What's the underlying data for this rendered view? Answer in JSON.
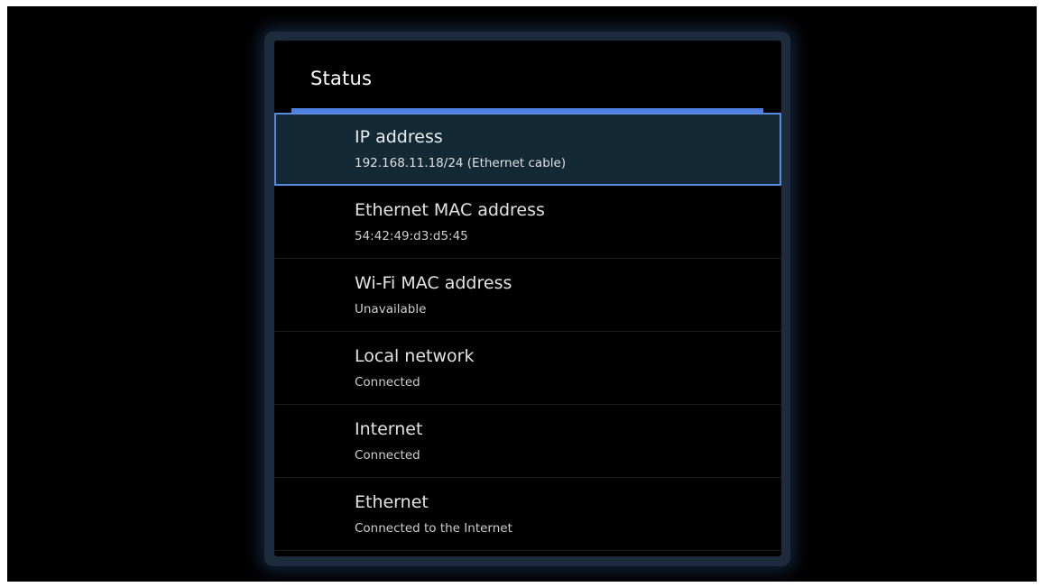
{
  "panel": {
    "title": "Status"
  },
  "items": [
    {
      "label": "IP address",
      "value": "192.168.11.18/24 (Ethernet cable)",
      "selected": true
    },
    {
      "label": "Ethernet MAC address",
      "value": "54:42:49:d3:d5:45",
      "selected": false
    },
    {
      "label": "Wi-Fi MAC address",
      "value": "Unavailable",
      "selected": false
    },
    {
      "label": "Local network",
      "value": "Connected",
      "selected": false
    },
    {
      "label": "Internet",
      "value": "Connected",
      "selected": false
    },
    {
      "label": "Ethernet",
      "value": "Connected to the Internet",
      "selected": false
    }
  ],
  "colors": {
    "accent": "#4d7fe0",
    "selected_bg": "#132936",
    "background": "#000000"
  }
}
